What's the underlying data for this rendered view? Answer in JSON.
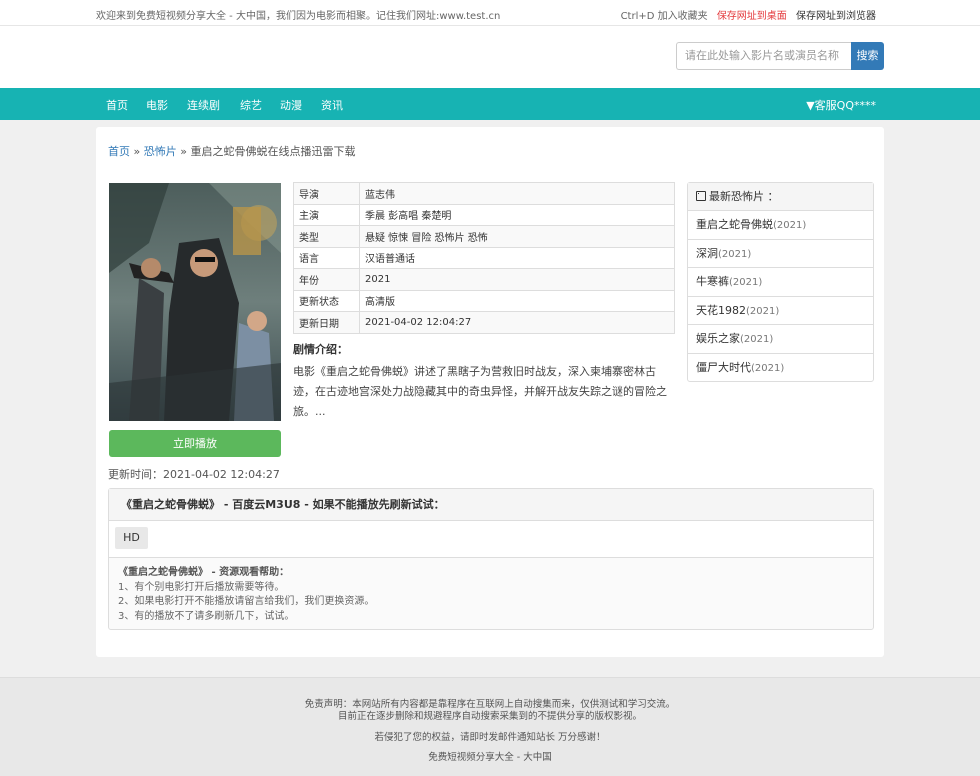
{
  "topbar": {
    "welcome": "欢迎来到免费短视频分享大全 - 大中国，我们因为电影而相聚。记住我们网址:www.test.cn",
    "shortcut": "Ctrl+D 加入收藏夹",
    "save_desktop": "保存网址到桌面",
    "save_browser": "保存网址到浏览器"
  },
  "search": {
    "placeholder": "请在此处输入影片名或演员名称",
    "button": "搜索"
  },
  "nav": {
    "items": [
      "首页",
      "电影",
      "连续剧",
      "综艺",
      "动漫",
      "资讯"
    ],
    "qq": "▼客服QQ****"
  },
  "breadcrumb": {
    "home": "首页",
    "sep1": " » ",
    "category": "恐怖片",
    "sep2": " » ",
    "current": "重启之蛇骨佛蜕在线点播迅雷下载"
  },
  "movie": {
    "play_button": "立即播放",
    "update_line": "更新时间：2021-04-02 12:04:27",
    "info": [
      {
        "k": "导演",
        "v": "蓝志伟"
      },
      {
        "k": "主演",
        "v": "季晨 彭高唱 秦楚明"
      },
      {
        "k": "类型",
        "v": "悬疑 惊悚 冒险 恐怖片 恐怖"
      },
      {
        "k": "语言",
        "v": "汉语普通话"
      },
      {
        "k": "年份",
        "v": "2021"
      },
      {
        "k": "更新状态",
        "v": "高清版"
      },
      {
        "k": "更新日期",
        "v": "2021-04-02 12:04:27"
      }
    ],
    "plot_title": "剧情介绍：",
    "plot": "电影《重启之蛇骨佛蜕》讲述了黑瞎子为营救旧时战友，深入柬埔寨密林古迹，在古迹地宫深处力战隐藏其中的奇虫异怪，并解开战友失踪之谜的冒险之旅。..."
  },
  "sidebar": {
    "title": "最新恐怖片 ：",
    "items": [
      {
        "name": "重启之蛇骨佛蜕",
        "year": "(2021)"
      },
      {
        "name": "深洞",
        "year": "(2021)"
      },
      {
        "name": "牛寒裤",
        "year": "(2021)"
      },
      {
        "name": "天花1982",
        "year": "(2021)"
      },
      {
        "name": "娱乐之家",
        "year": "(2021)"
      },
      {
        "name": "僵尸大时代",
        "year": "(2021)"
      }
    ]
  },
  "player": {
    "title": "《重启之蛇骨佛蜕》 - 百度云M3U8 - 如果不能播放先刷新试试：",
    "episode": "HD",
    "help_title": "《重启之蛇骨佛蜕》 - 资源观看帮助：",
    "help": [
      "1、有个别电影打开后播放需要等待。",
      "2、如果电影打开不能播放请留言给我们，我们更换资源。",
      "3、有的播放不了请多刷新几下，试试。"
    ]
  },
  "footer": {
    "line1": "免责声明：本网站所有内容都是靠程序在互联网上自动搜集而来，仅供测试和学习交流。",
    "line2": "目前正在逐步删除和规避程序自动搜索采集到的不提供分享的版权影视。",
    "line3": "若侵犯了您的权益，请即时发邮件通知站长 万分感谢！",
    "line4": "免费短视频分享大全 - 大中国"
  },
  "colors": {
    "nav": "#17b3b3",
    "play": "#5cb85c",
    "search": "#337ab7",
    "link": "#337ab7",
    "alert": "#e4393c"
  },
  "icons": {
    "sidebar_head": "film-icon"
  }
}
